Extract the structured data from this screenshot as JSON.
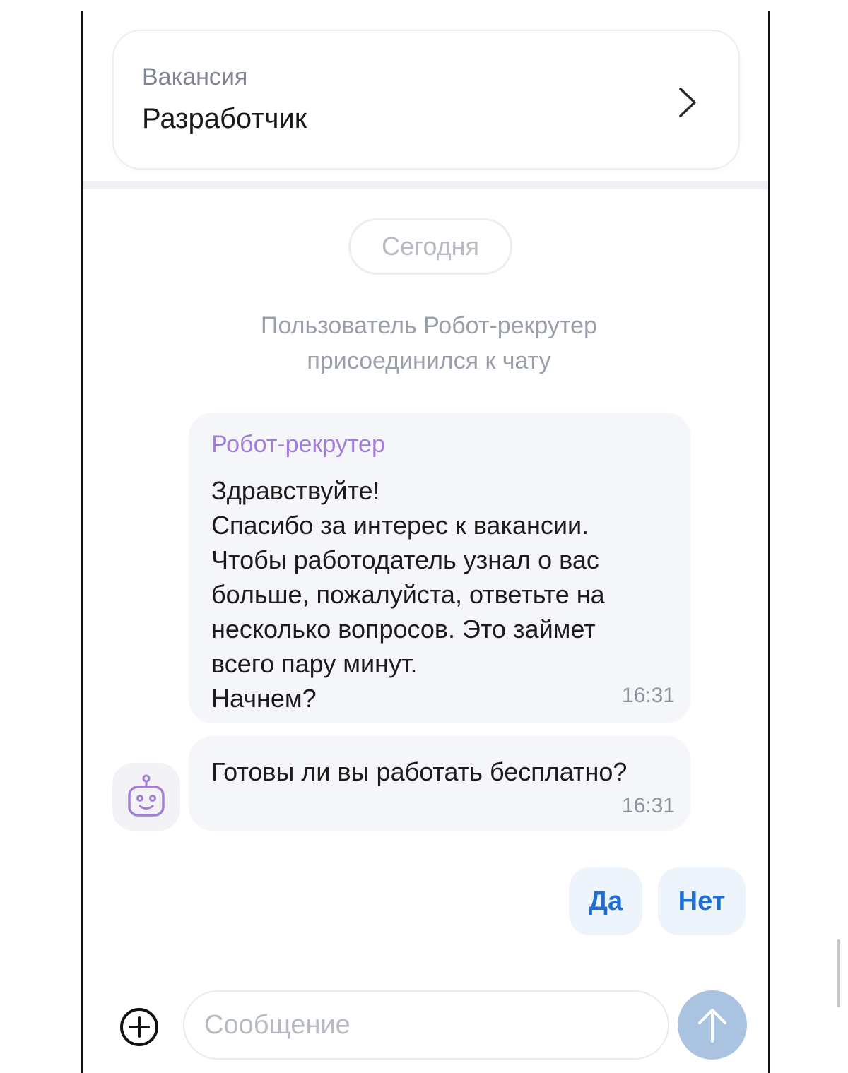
{
  "vacancy": {
    "label": "Вакансия",
    "title": "Разработчик"
  },
  "chat": {
    "date_separator": "Сегодня",
    "system_message": {
      "line1": "Пользователь Робот-рекрутер",
      "line2": "присоединился к чату"
    },
    "messages": [
      {
        "sender": "Робот-рекрутер",
        "lines": [
          "Здравствуйте!",
          "Спасибо за интерес к вакансии.",
          "Чтобы работодатель узнал о вас",
          "больше, пожалуйста, ответьте на",
          "несколько вопросов. Это займет",
          "всего пару минут.",
          "Начнем?"
        ],
        "time": "16:31"
      },
      {
        "text": "Готовы ли вы работать бесплатно?",
        "time": "16:31"
      }
    ],
    "quick_replies": {
      "yes": "Да",
      "no": "Нет"
    }
  },
  "composer": {
    "placeholder": "Сообщение"
  },
  "icons": {
    "chevron": "chevron-right-icon",
    "avatar": "robot-icon",
    "attach": "plus-circle-icon",
    "send": "arrow-up-icon"
  },
  "colors": {
    "sender_name": "#a27ed6",
    "quick_reply_text": "#1f6fd1",
    "quick_reply_bg": "#eef4fb",
    "send_button": "#a9c3e0",
    "bubble_bg": "#f5f6fa"
  }
}
